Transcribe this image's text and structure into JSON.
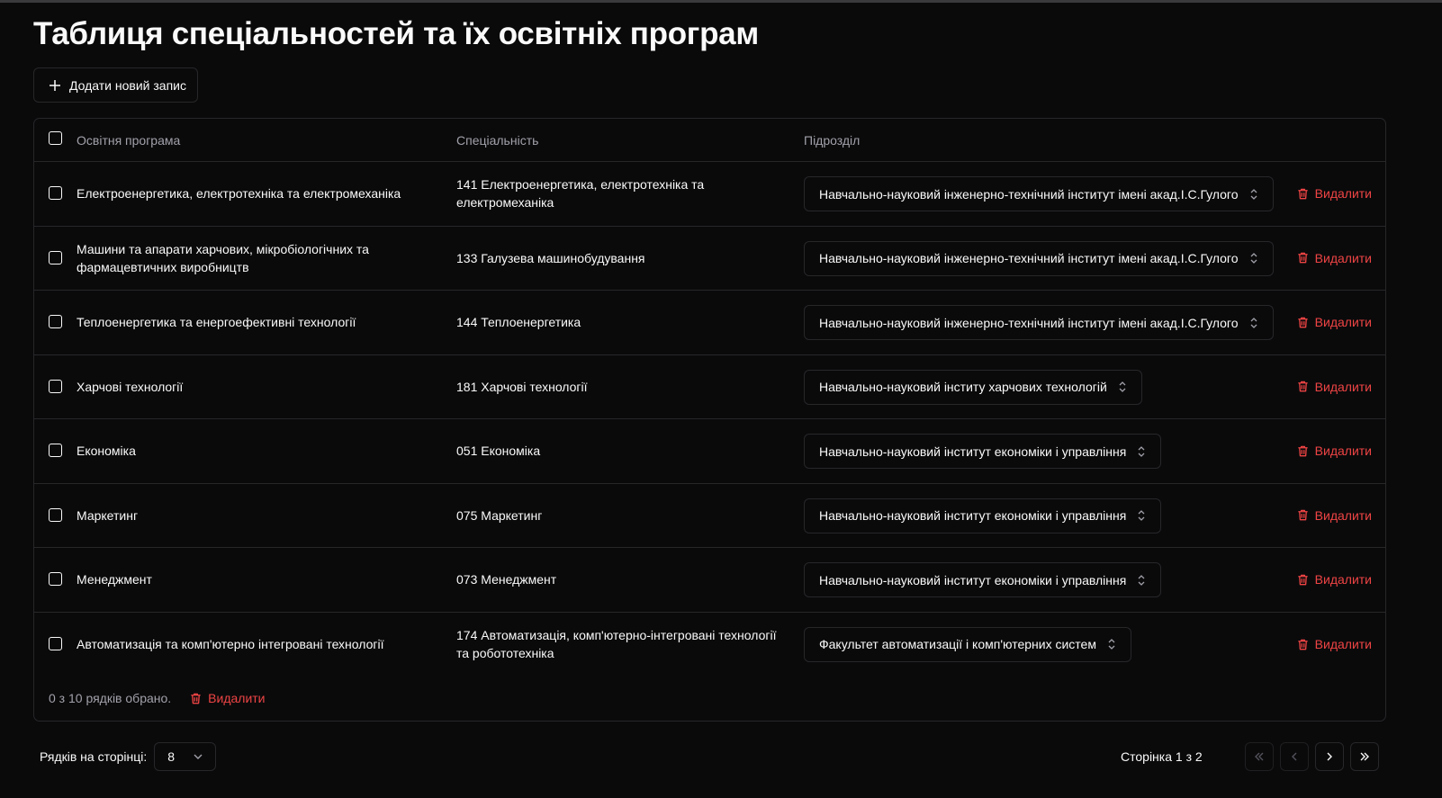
{
  "page": {
    "title": "Таблиця спеціальностей та їх освітніх програм",
    "add_button_label": "Додати новий запис"
  },
  "table": {
    "headers": {
      "program": "Освітня програма",
      "specialty": "Спеціальність",
      "department": "Підрозділ"
    },
    "delete_label": "Видалити",
    "rows": [
      {
        "program": "Електроенергетика, електротехніка та електромеханіка",
        "specialty": "141 Електроенергетика, електротехніка та електромеханіка",
        "department": "Навчально-науковий інженерно-технічний інститут імені акад.І.С.Гулого"
      },
      {
        "program": "Машини та апарати харчових, мікробіологічних та фармацевтичних виробництв",
        "specialty": "133 Галузева машинобудування",
        "department": "Навчально-науковий інженерно-технічний інститут імені акад.І.С.Гулого"
      },
      {
        "program": "Теплоенергетика та енергоефективні технології",
        "specialty": "144 Теплоенергетика",
        "department": "Навчально-науковий інженерно-технічний інститут імені акад.І.С.Гулого"
      },
      {
        "program": "Харчові технології",
        "specialty": "181 Харчові технології",
        "department": "Навчально-науковий інститу харчових технологій"
      },
      {
        "program": "Економіка",
        "specialty": "051 Економіка",
        "department": "Навчально-науковий інститут економіки і управління"
      },
      {
        "program": "Маркетинг",
        "specialty": "075 Маркетинг",
        "department": "Навчально-науковий інститут економіки і управління"
      },
      {
        "program": "Менеджмент",
        "specialty": "073 Менеджмент",
        "department": "Навчально-науковий інститут економіки і управління"
      },
      {
        "program": "Автоматизація та комп'ютерно інтегровані технології",
        "specialty": "174 Автоматизація, комп'ютерно-інтегровані технології та робототехніка",
        "department": "Факультет автоматизації і комп'ютерних систем"
      }
    ],
    "selection_status": "0 з 10 рядків обрано.",
    "bulk_delete_label": "Видалити"
  },
  "pagination": {
    "rows_per_page_label": "Рядків на сторінці:",
    "rows_per_page_value": "8",
    "page_info": "Сторінка 1 з 2"
  },
  "colors": {
    "background": "#0a0a0b",
    "border": "#27272a",
    "muted_text": "#a1a1aa",
    "danger": "#ef4444"
  }
}
